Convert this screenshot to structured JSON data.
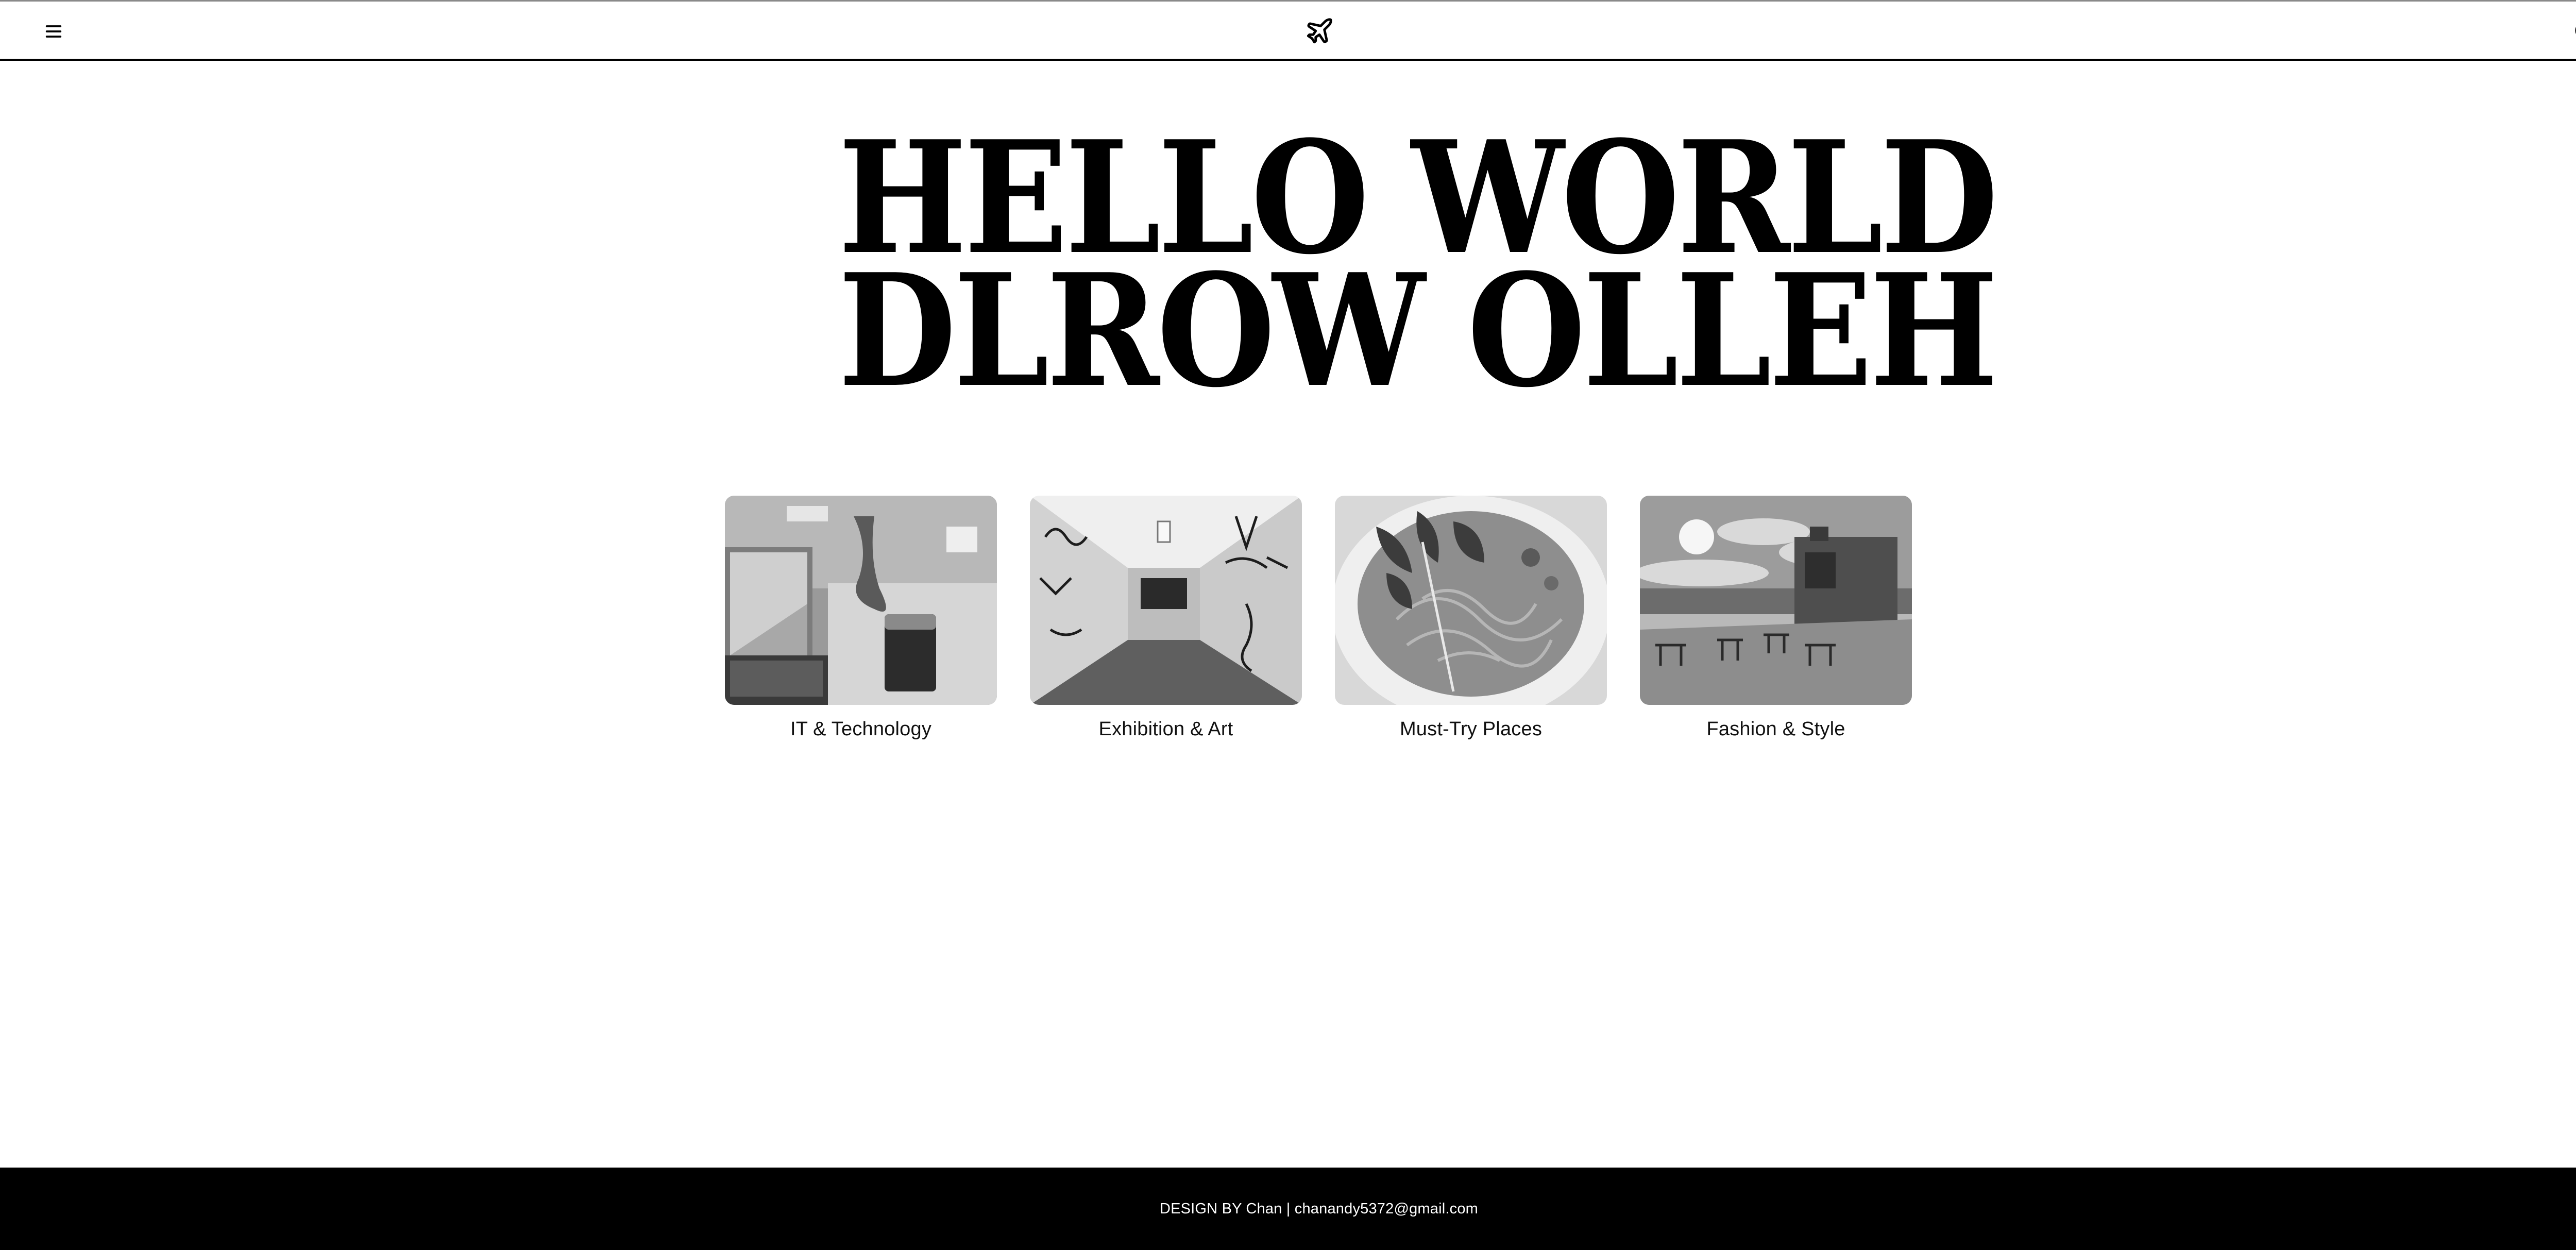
{
  "header": {
    "menu_icon": "hamburger-menu-icon",
    "logo_icon": "airplane-icon",
    "search_icon": "search-icon"
  },
  "hero": {
    "line1": "HELLO WORLD",
    "line2": "DLROW OLLEH"
  },
  "categories": [
    {
      "label": "IT & Technology",
      "image": "laptop-and-iced-coffee-photo"
    },
    {
      "label": "Exhibition & Art",
      "image": "graffiti-corridor-photo"
    },
    {
      "label": "Must-Try Places",
      "image": "pasta-with-greens-photo"
    },
    {
      "label": "Fashion & Style",
      "image": "rooftop-terrace-photo"
    }
  ],
  "footer": {
    "text": "DESIGN BY Chan | chanandy5372@gmail.com"
  },
  "colors": {
    "background": "#ffffff",
    "text": "#000000",
    "footer_bg": "#000000",
    "footer_text": "#ffffff"
  }
}
